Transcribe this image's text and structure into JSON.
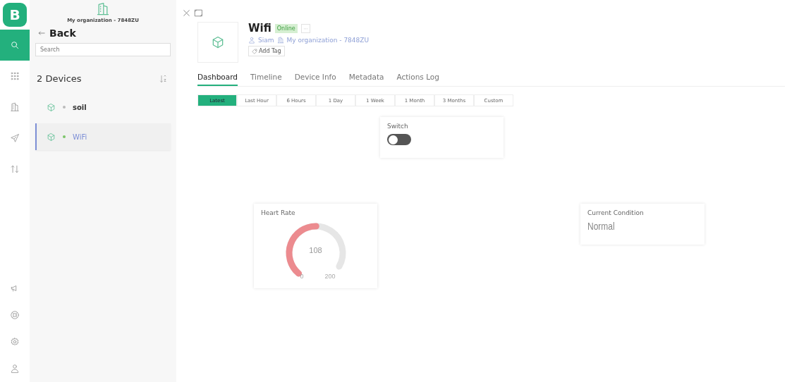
{
  "rail": {
    "logo": "B",
    "items": [
      {
        "selected": true
      },
      {
        "selected": false
      },
      {
        "selected": false
      },
      {
        "selected": false
      },
      {
        "selected": false
      }
    ]
  },
  "sidebar": {
    "organization": "My organization - 7848ZU",
    "back": "Back",
    "search": {
      "placeholder": "Search"
    },
    "count": "2 Devices",
    "devices": [
      {
        "name": "soil",
        "online": false,
        "selected": false
      },
      {
        "name": "WiFi",
        "online": true,
        "selected": true
      }
    ]
  },
  "device": {
    "name": "Wifi",
    "status": "Online",
    "more": "···",
    "owner": "Siam",
    "organization": "My organization - 7848ZU",
    "add_tag": "Add Tag"
  },
  "tabs": [
    {
      "label": "Dashboard",
      "selected": true
    },
    {
      "label": "Timeline",
      "selected": false
    },
    {
      "label": "Device Info",
      "selected": false
    },
    {
      "label": "Metadata",
      "selected": false
    },
    {
      "label": "Actions Log",
      "selected": false
    }
  ],
  "ranges": [
    {
      "label": "Latest",
      "selected": true
    },
    {
      "label": "Last Hour",
      "selected": false
    },
    {
      "label": "6 Hours",
      "selected": false
    },
    {
      "label": "1 Day",
      "selected": false
    },
    {
      "label": "1 Week",
      "selected": false
    },
    {
      "label": "1 Month",
      "selected": false
    },
    {
      "label": "3 Months",
      "selected": false
    },
    {
      "label": "Custom",
      "selected": false
    }
  ],
  "widgets": [
    {
      "kind": "switch",
      "title": "Switch",
      "on": false
    },
    {
      "kind": "gauge",
      "title": "Heart Rate",
      "value": "108",
      "min": "0",
      "max": "200"
    },
    {
      "kind": "value",
      "title": "Current Condition",
      "value": "Normal"
    }
  ]
}
